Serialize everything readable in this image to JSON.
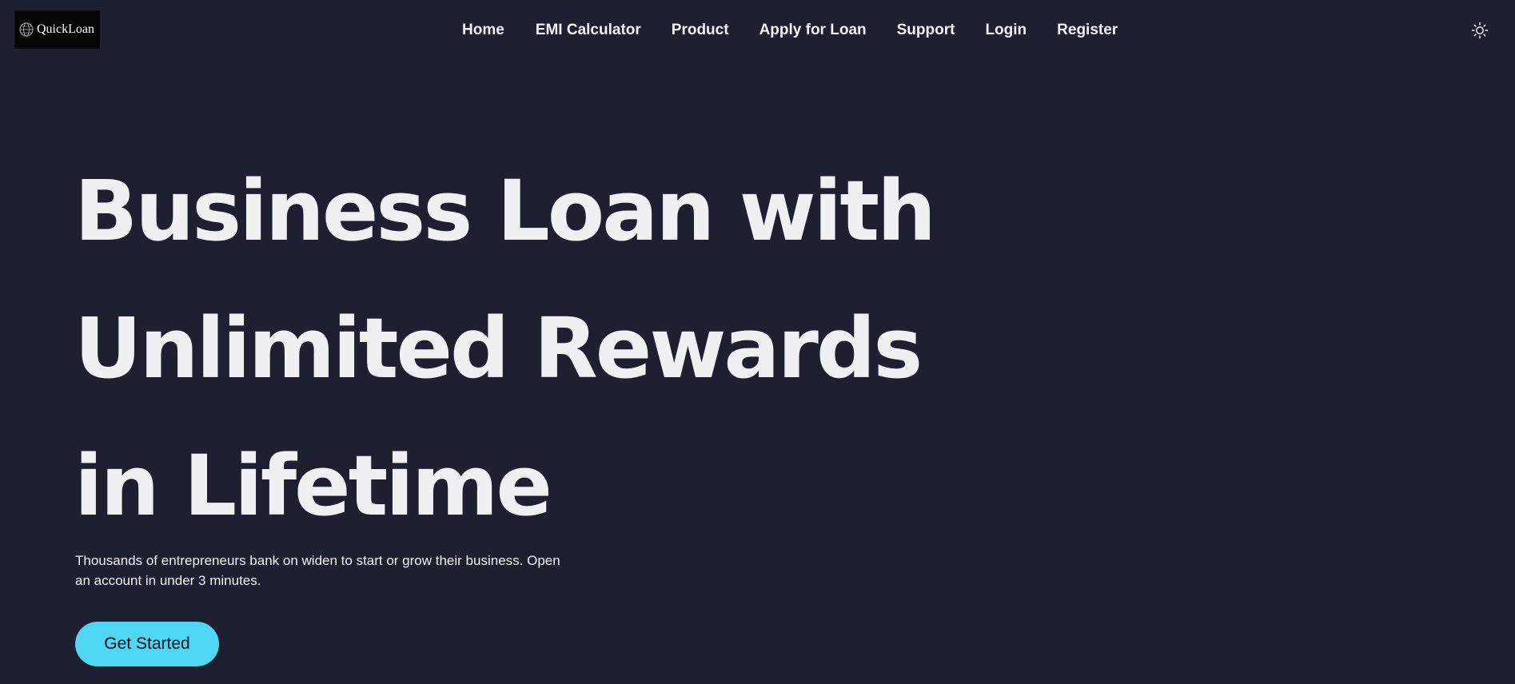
{
  "brand": {
    "name": "QuickLoan",
    "icon": "globe-icon"
  },
  "nav": {
    "items": [
      {
        "label": "Home"
      },
      {
        "label": "EMI Calculator"
      },
      {
        "label": "Product"
      },
      {
        "label": "Apply for Loan"
      },
      {
        "label": "Support"
      },
      {
        "label": "Login"
      },
      {
        "label": "Register"
      }
    ],
    "theme_icon": "sun-icon"
  },
  "hero": {
    "title_lines": [
      "Business Loan with",
      "Unlimited Rewards",
      "in Lifetime"
    ],
    "subtitle": "Thousands of entrepreneurs bank on widen to start or grow their business. Open an account in under 3 minutes.",
    "cta_label": "Get Started"
  },
  "colors": {
    "background": "#1c2030",
    "text": "#eef0f2",
    "accent": "#4fd6f3"
  }
}
